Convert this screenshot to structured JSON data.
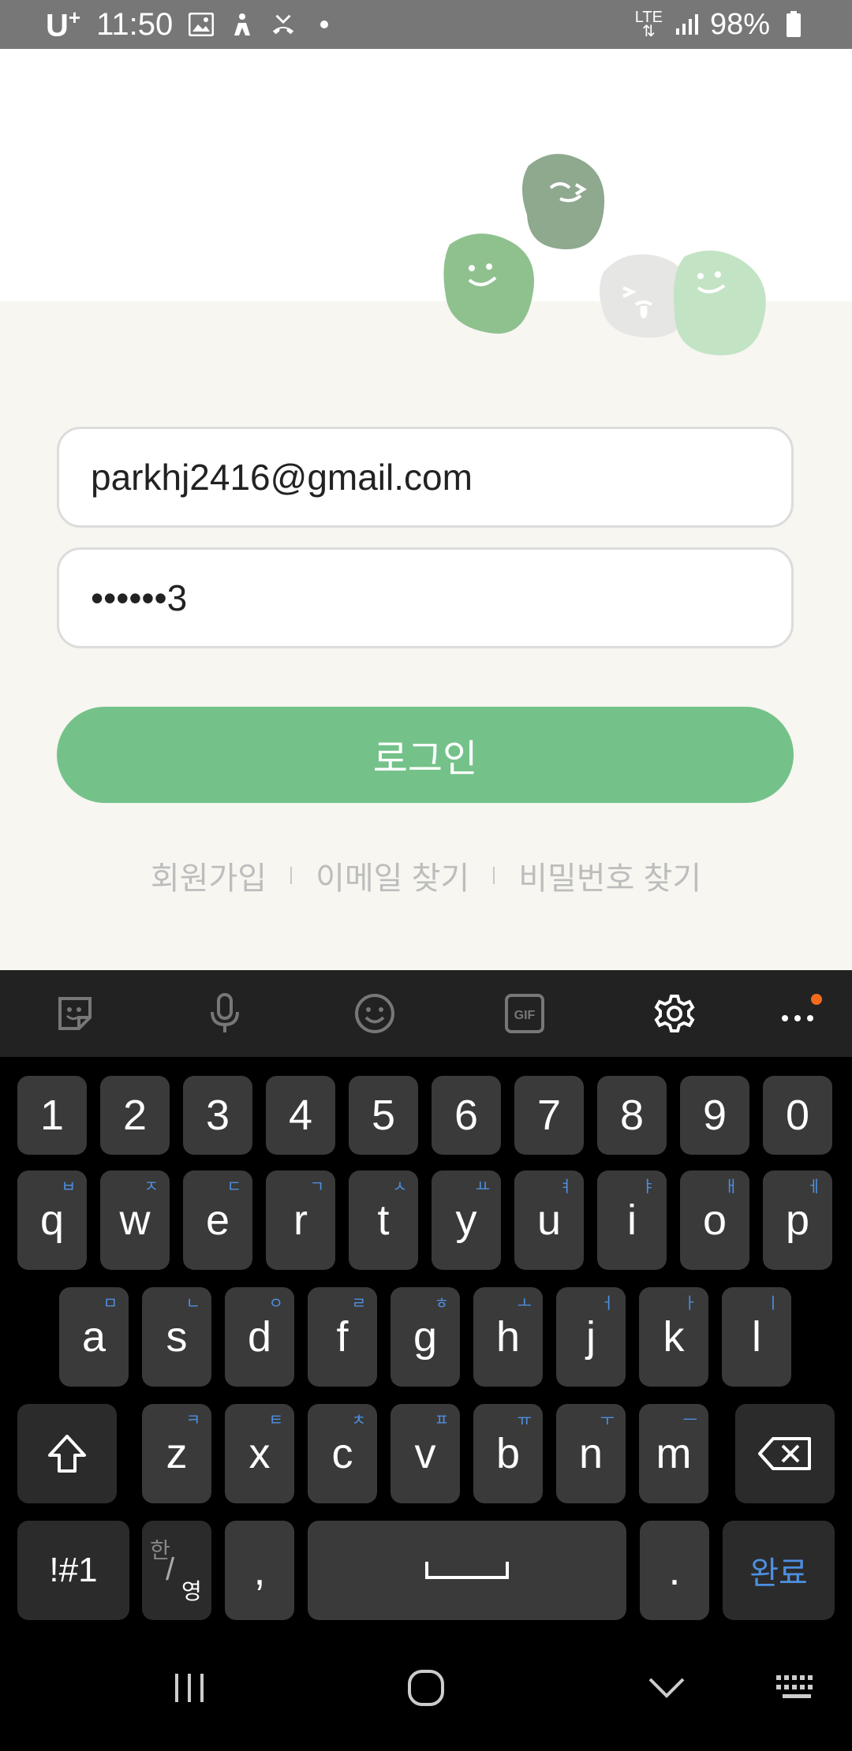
{
  "status_bar": {
    "carrier": "U",
    "carrier_sup": "+",
    "time": "11:50",
    "network": "LTE",
    "battery": "98%",
    "left_icons": [
      "gallery-icon",
      "accessibility-icon",
      "missed-call-icon",
      "dot-icon"
    ],
    "right_icons": [
      "lte-icon",
      "signal-icon",
      "battery-icon"
    ]
  },
  "login": {
    "email_value": "parkhj2416@gmail.com",
    "password_value": "••••••3",
    "login_label": "로그인",
    "links": {
      "signup": "회원가입",
      "find_email": "이메일 찾기",
      "find_password": "비밀번호 찾기"
    }
  },
  "keyboard": {
    "toolbar_icons": [
      "sticker-icon",
      "microphone-icon",
      "emoji-icon",
      "gif-icon",
      "settings-icon",
      "more-icon"
    ],
    "number_row": [
      "1",
      "2",
      "3",
      "4",
      "5",
      "6",
      "7",
      "8",
      "9",
      "0"
    ],
    "row1": [
      {
        "key": "q",
        "hint": "ㅂ"
      },
      {
        "key": "w",
        "hint": "ㅈ"
      },
      {
        "key": "e",
        "hint": "ㄷ"
      },
      {
        "key": "r",
        "hint": "ㄱ"
      },
      {
        "key": "t",
        "hint": "ㅅ"
      },
      {
        "key": "y",
        "hint": "ㅛ"
      },
      {
        "key": "u",
        "hint": "ㅕ"
      },
      {
        "key": "i",
        "hint": "ㅑ"
      },
      {
        "key": "o",
        "hint": "ㅐ"
      },
      {
        "key": "p",
        "hint": "ㅔ"
      }
    ],
    "row2": [
      {
        "key": "a",
        "hint": "ㅁ"
      },
      {
        "key": "s",
        "hint": "ㄴ"
      },
      {
        "key": "d",
        "hint": "ㅇ"
      },
      {
        "key": "f",
        "hint": "ㄹ"
      },
      {
        "key": "g",
        "hint": "ㅎ"
      },
      {
        "key": "h",
        "hint": "ㅗ"
      },
      {
        "key": "j",
        "hint": "ㅓ"
      },
      {
        "key": "k",
        "hint": "ㅏ"
      },
      {
        "key": "l",
        "hint": "ㅣ"
      }
    ],
    "row3": [
      {
        "key": "z",
        "hint": "ㅋ"
      },
      {
        "key": "x",
        "hint": "ㅌ"
      },
      {
        "key": "c",
        "hint": "ㅊ"
      },
      {
        "key": "v",
        "hint": "ㅍ"
      },
      {
        "key": "b",
        "hint": "ㅠ"
      },
      {
        "key": "n",
        "hint": "ㅜ"
      },
      {
        "key": "m",
        "hint": "ㅡ"
      }
    ],
    "symbols_label": "!#1",
    "lang_top": "한",
    "lang_bottom": "영",
    "comma": ",",
    "period": ".",
    "done_label": "완료"
  },
  "navbar": {
    "icons": [
      "recent-apps-icon",
      "home-icon",
      "back-icon",
      "keyboard-icon"
    ]
  },
  "colors": {
    "accent_green": "#74c28a",
    "keyboard_hint": "#4d8fe0"
  }
}
